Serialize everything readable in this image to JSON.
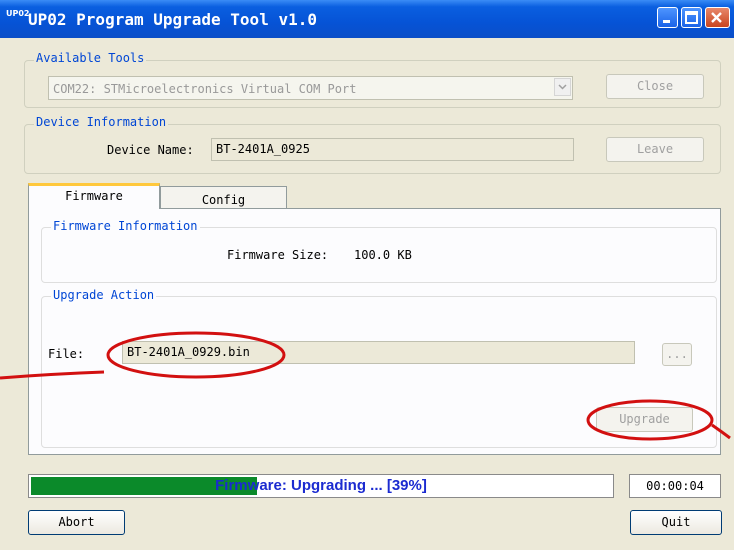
{
  "window": {
    "title": "UP02 Program Upgrade Tool v1.0",
    "icon_text": "UP02",
    "controls": [
      "minimize-icon",
      "maximize-icon",
      "close-icon"
    ]
  },
  "available_tools": {
    "label": "Available Tools",
    "port_value": "COM22: STMicroelectronics Virtual COM Port",
    "close_button": "Close"
  },
  "device_information": {
    "label": "Device Information",
    "device_name_label": "Device Name:",
    "device_name_value": "BT-2401A_0925",
    "leave_button": "Leave"
  },
  "tabs": [
    {
      "label": "Firmware",
      "active": true
    },
    {
      "label": "Config",
      "active": false
    }
  ],
  "firmware_information": {
    "label": "Firmware Information",
    "size_label": "Firmware Size:",
    "size_value": "100.0 KB"
  },
  "upgrade_action": {
    "label": "Upgrade Action",
    "file_label": "File:",
    "file_value": "BT-2401A_0929.bin",
    "browse_button": "...",
    "upgrade_button": "Upgrade"
  },
  "progress": {
    "text": "Firmware: Upgrading ... [39%]",
    "percent": 39,
    "elapsed": "00:00:04"
  },
  "footer": {
    "abort_button": "Abort",
    "quit_button": "Quit"
  },
  "colors": {
    "accent": "#0a5fe0",
    "group_label": "#0046d5",
    "progress_fill": "#0b8a2a",
    "progress_text": "#1b2bd0",
    "annotation": "#d21010"
  }
}
